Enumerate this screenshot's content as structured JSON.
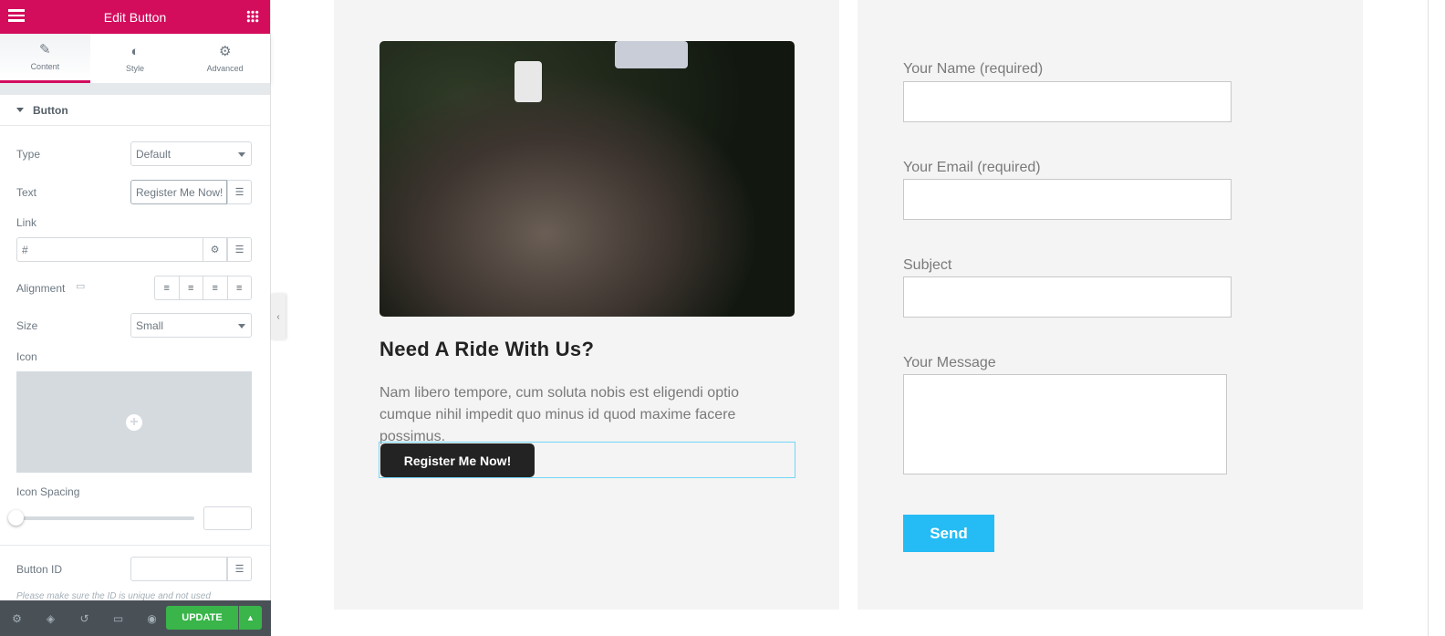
{
  "panel": {
    "title": "Edit Button",
    "tabs": [
      {
        "label": "Content",
        "icon": "pencil-icon"
      },
      {
        "label": "Style",
        "icon": "half-circle-icon"
      },
      {
        "label": "Advanced",
        "icon": "gear-icon"
      }
    ],
    "section": "Button",
    "type_label": "Type",
    "type_value": "Default",
    "text_label": "Text",
    "text_value": "Register Me Now!",
    "link_label": "Link",
    "link_value": "#",
    "alignment_label": "Alignment",
    "size_label": "Size",
    "size_value": "Small",
    "icon_label": "Icon",
    "icon_spacing_label": "Icon Spacing",
    "icon_spacing_value": "",
    "button_id_label": "Button ID",
    "button_id_value": "",
    "note": "Please make sure the ID is unique and not used",
    "update": "UPDATE",
    "accent": "#d30c5c"
  },
  "content": {
    "heading": "Need A Ride With Us?",
    "description": "Nam libero tempore, cum soluta nobis est eligendi optio cumque nihil impedit quo minus id quod maxime facere possimus.",
    "button": "Register Me Now!"
  },
  "form": {
    "name": "Your Name (required)",
    "email": "Your Email (required)",
    "subject": "Subject",
    "message": "Your Message",
    "send": "Send",
    "send_color": "#25bcf5"
  }
}
